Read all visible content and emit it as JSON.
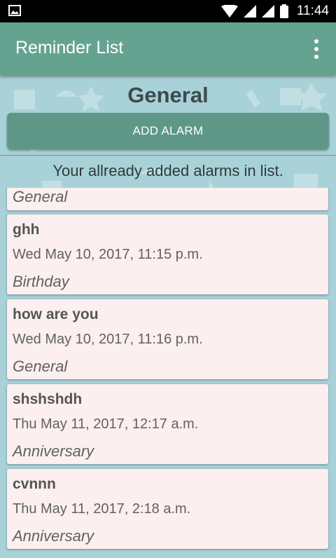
{
  "status_bar": {
    "time": "11:44"
  },
  "app_bar": {
    "title": "Reminder List"
  },
  "category_heading": "General",
  "add_button_label": "ADD ALARM",
  "hint_text": "Your allready added alarms in list.",
  "alarms": [
    {
      "title": "",
      "date": "",
      "category": "General"
    },
    {
      "title": "ghh",
      "date": "Wed May 10, 2017, 11:15 p.m.",
      "category": "Birthday"
    },
    {
      "title": "how are you",
      "date": "Wed May 10, 2017, 11:16 p.m.",
      "category": "General"
    },
    {
      "title": "shshshdh",
      "date": "Thu May 11, 2017, 12:17 a.m.",
      "category": "Anniversary"
    },
    {
      "title": "cvnnn",
      "date": "Thu May 11, 2017, 2:18 a.m.",
      "category": "Anniversary"
    }
  ],
  "colors": {
    "app_bar": "#65a391",
    "button": "#5e9787",
    "background": "#a9d2d8",
    "card": "#fcefef"
  }
}
